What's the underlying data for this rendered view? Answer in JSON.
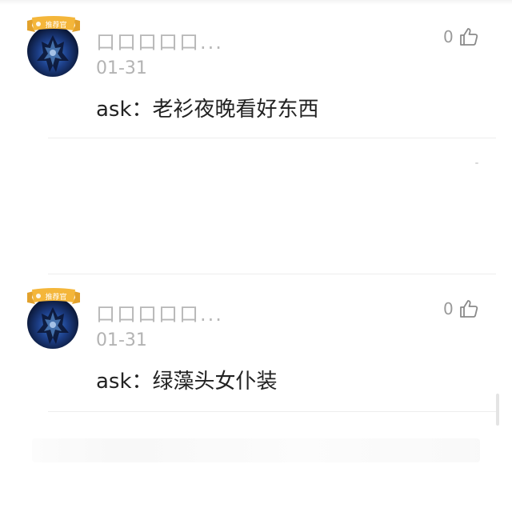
{
  "comments": [
    {
      "badge_text": "推荐官",
      "username": "口口口口口...",
      "date": "01-31",
      "content": "ask：老衫夜晚看好东西",
      "like_count": "0"
    },
    {
      "badge_text": "推荐官",
      "username": "口口口口口...",
      "date": "01-31",
      "content": "ask：绿藻头女仆装",
      "like_count": "0"
    }
  ],
  "colors": {
    "badge_gold": "#f4b63a",
    "text_primary": "#222222",
    "text_muted": "#b3b3b3"
  },
  "icons": {
    "like": "thumbs-up-icon",
    "badge": "ribbon-badge-icon"
  }
}
